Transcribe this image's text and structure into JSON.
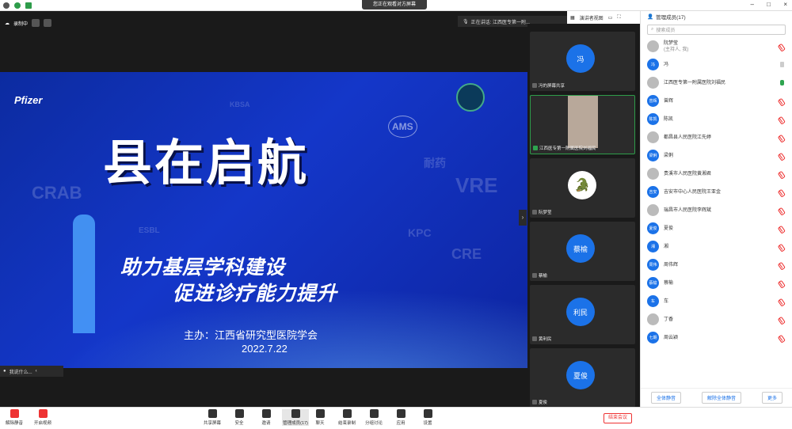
{
  "topbar": {
    "share_notice": "您正在观看对方屏幕",
    "window_controls": [
      "–",
      "□",
      "×"
    ]
  },
  "recording": {
    "label": "录制中"
  },
  "speaking": {
    "label": "正在讲话: 江西医专第一附..."
  },
  "view": {
    "mode_label": "演讲者视图"
  },
  "slide": {
    "logo": "Pfizer",
    "title": "县在启航",
    "subtitle1": "助力基层学科建设",
    "subtitle2": "促进诊疗能力提升",
    "host": "主办：江西省研究型医院学会",
    "date": "2022.7.22",
    "ghost_words": [
      "CRAB",
      "ESBL",
      "KPC",
      "CRE",
      "VRE",
      "AMS",
      "KBSA",
      "耐药"
    ]
  },
  "talk": {
    "label": "我说什么..."
  },
  "tiles": [
    {
      "avatar": "冯",
      "name": "冯的屏幕共享",
      "type": "avatar"
    },
    {
      "avatar": "",
      "name": "江西医专第一附属医院刘福民",
      "type": "camera"
    },
    {
      "avatar": "",
      "name": "阮梦莹",
      "type": "gator"
    },
    {
      "avatar": "蔡榆",
      "name": "蔡榆",
      "type": "avatar"
    },
    {
      "avatar": "利民",
      "name": "黄利民",
      "type": "avatar"
    },
    {
      "avatar": "夏俊",
      "name": "夏俊",
      "type": "avatar"
    }
  ],
  "side": {
    "title": "管理成员(17)",
    "search_placeholder": "搜索成员",
    "members": [
      {
        "avatar": "",
        "name": "阮梦莹",
        "sub": "(主持人, 我)",
        "mic": "muted",
        "img": true
      },
      {
        "avatar": "冯",
        "name": "冯",
        "sub": "",
        "mic": "grey",
        "img": false
      },
      {
        "avatar": "",
        "name": "江西医专第一附属医院刘福民",
        "sub": "",
        "mic": "on",
        "img": true
      },
      {
        "avatar": "曾辉",
        "name": "曾辉",
        "sub": "",
        "mic": "muted",
        "img": false
      },
      {
        "avatar": "陈凯",
        "name": "陈凯",
        "sub": "",
        "mic": "muted",
        "img": false
      },
      {
        "avatar": "",
        "name": "都昌县人民医院江先婷",
        "sub": "",
        "mic": "muted",
        "img": true
      },
      {
        "avatar": "梁俐",
        "name": "梁俐",
        "sub": "",
        "mic": "muted",
        "img": false
      },
      {
        "avatar": "",
        "name": "贵溪市人民医院黄湘君",
        "sub": "",
        "mic": "muted",
        "img": true
      },
      {
        "avatar": "吉安",
        "name": "吉安市中心人民医院王亚金",
        "sub": "",
        "mic": "muted",
        "img": false
      },
      {
        "avatar": "",
        "name": "瑞昌市人民医院李辉斌",
        "sub": "",
        "mic": "muted",
        "img": true
      },
      {
        "avatar": "夏俊",
        "name": "夏俊",
        "sub": "",
        "mic": "muted",
        "img": false
      },
      {
        "avatar": "湘",
        "name": "湘",
        "sub": "",
        "mic": "muted",
        "img": false
      },
      {
        "avatar": "周伟",
        "name": "周伟辉",
        "sub": "",
        "mic": "muted",
        "img": false
      },
      {
        "avatar": "蔡榆",
        "name": "蔡榆",
        "sub": "",
        "mic": "muted",
        "img": false
      },
      {
        "avatar": "车",
        "name": "车",
        "sub": "",
        "mic": "muted",
        "img": false
      },
      {
        "avatar": "",
        "name": "丁香",
        "sub": "",
        "mic": "muted",
        "img": true
      },
      {
        "avatar": "七期",
        "name": "周云颖",
        "sub": "",
        "mic": "muted",
        "img": false
      }
    ],
    "buttons": [
      "全体静音",
      "解除全体静音",
      "更多"
    ]
  },
  "toolbar": {
    "left": [
      "解除静音",
      "开启视频"
    ],
    "center": [
      "共享屏幕",
      "安全",
      "邀请",
      "管理成员(17)",
      "聊天",
      "结束录制",
      "分组讨论",
      "应用",
      "设置"
    ],
    "end": "结束会议"
  }
}
